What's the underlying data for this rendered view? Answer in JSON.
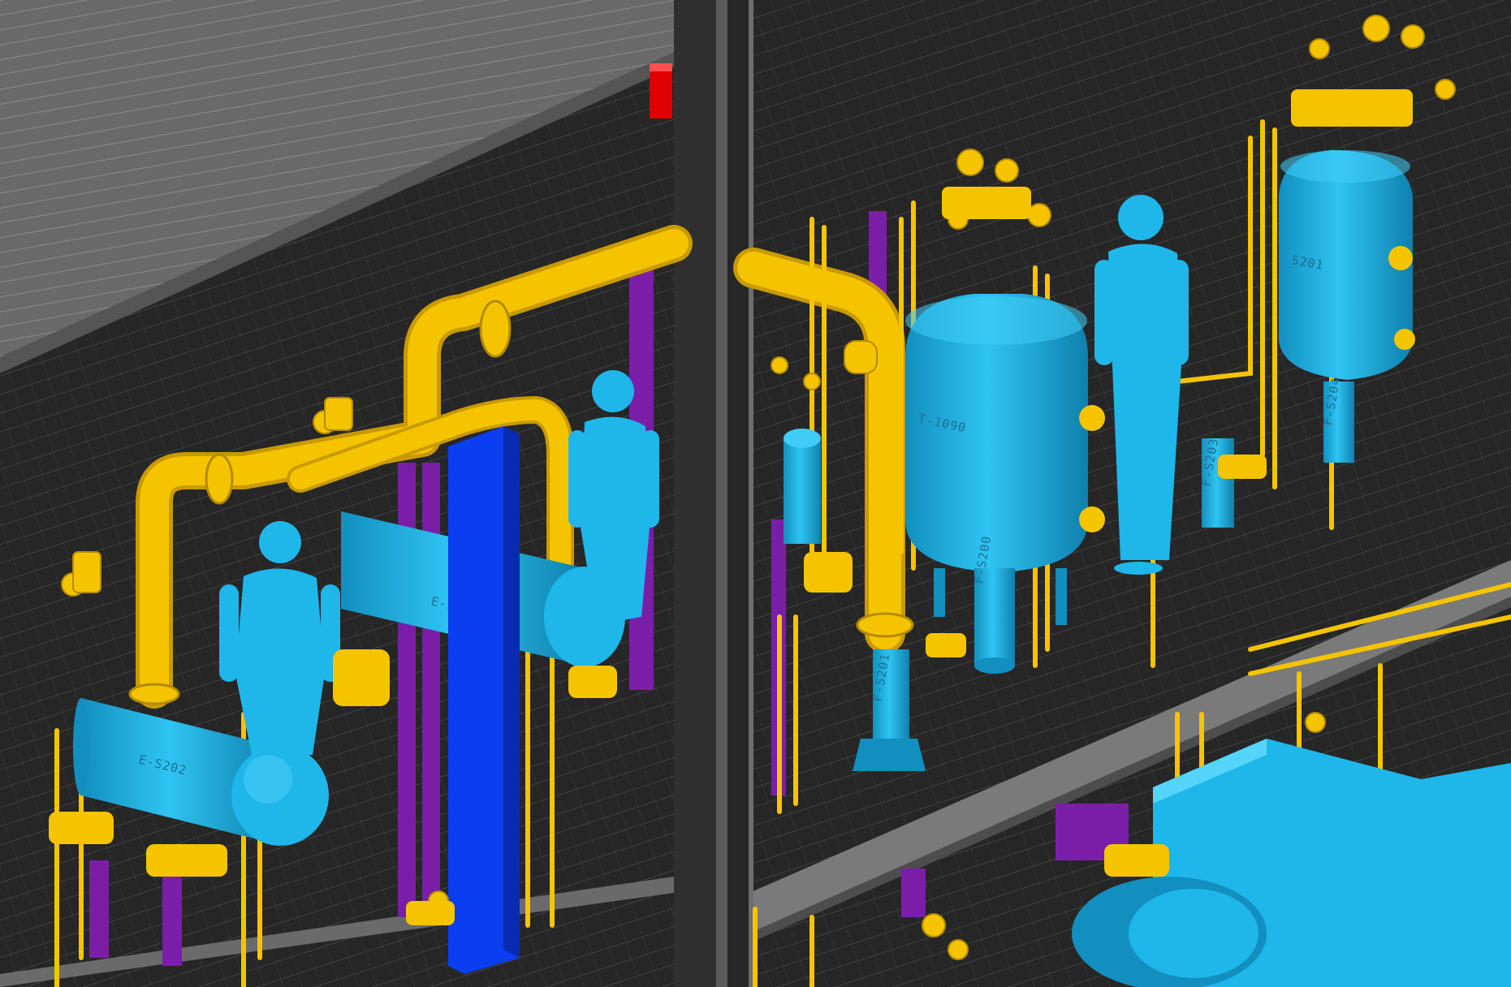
{
  "colors": {
    "background": "#3a3a3a",
    "grating": "#262626",
    "grating_line": "#5c5c5c",
    "roof": "#6e6e6e",
    "beam": "#7a7a7a",
    "pipe": "#f5c400",
    "pipe_shade": "#c99a00",
    "vessel": "#1fb6ea",
    "vessel_shade": "#128fbf",
    "steel": "#7a1ea8",
    "column": "#0a3ef0",
    "post": "#2f2f2f",
    "alarm": "#e00000"
  },
  "equipment_tags": {
    "separator_left": "E-S202",
    "separator_mid": "E-S",
    "tank_center": "T-1090",
    "filter_center": "F-S200",
    "filter_bottom": "F-S201",
    "vessel_right": "S201",
    "filter_right_a": "F-S203",
    "filter_right_b": "F-S204"
  }
}
